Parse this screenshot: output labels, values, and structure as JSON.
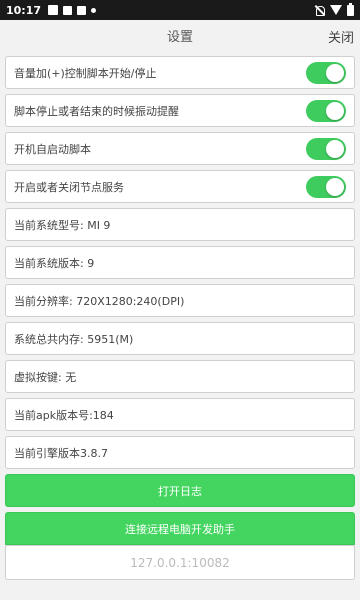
{
  "status_bar": {
    "time": "10:17",
    "left_icons": [
      "mail-icon",
      "image-icon",
      "download-icon",
      "dot-icon"
    ],
    "right_icons": [
      "mute-icon",
      "wifi-icon",
      "battery-icon"
    ]
  },
  "header": {
    "title": "设置",
    "close_label": "关闭"
  },
  "toggles": [
    {
      "label": "音量加(+)控制脚本开始/停止",
      "on": true
    },
    {
      "label": "脚本停止或者结束的时候振动提醒",
      "on": true
    },
    {
      "label": "开机自启动脚本",
      "on": true
    },
    {
      "label": "开启或者关闭节点服务",
      "on": true
    }
  ],
  "info": [
    "当前系统型号: MI 9",
    "当前系统版本: 9",
    "当前分辨率: 720X1280:240(DPI)",
    "系统总共内存: 5951(M)",
    "虚拟按键: 无",
    "当前apk版本号:184",
    "当前引擎版本3.8.7"
  ],
  "buttons": {
    "open_log": "打开日志",
    "connect_remote": "连接远程电脑开发助手"
  },
  "remote_input": {
    "placeholder": "127.0.0.1:10082",
    "value": ""
  },
  "colors": {
    "accent": "#43d560",
    "switch_on": "#3fcc5f",
    "status_bar": "#1a1a1a"
  }
}
